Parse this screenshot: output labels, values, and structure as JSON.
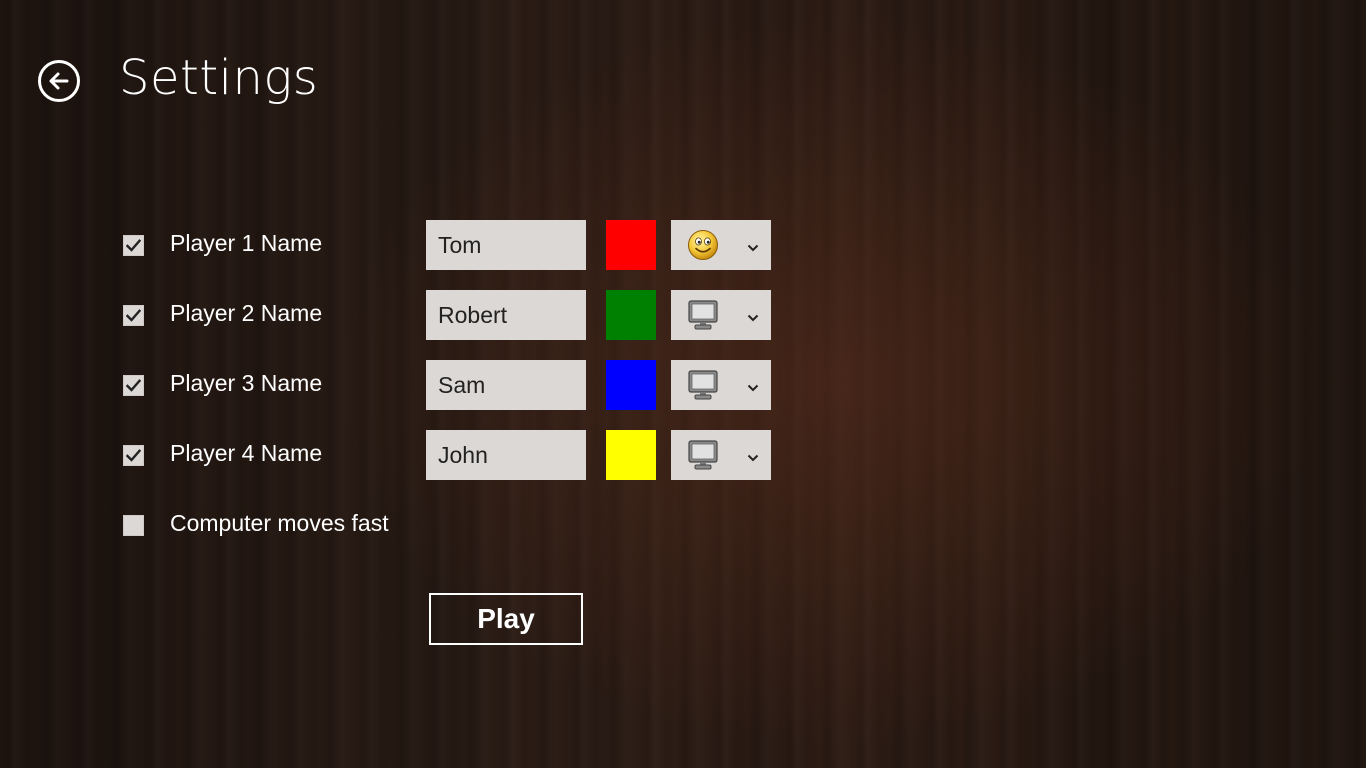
{
  "header": {
    "title": "Settings",
    "back_icon": "back-arrow-icon"
  },
  "players": [
    {
      "checked": true,
      "label": "Player 1 Name",
      "name": "Tom",
      "color": "#ff0000",
      "type_icon": "smiley-face-icon"
    },
    {
      "checked": true,
      "label": "Player 2 Name",
      "name": "Robert",
      "color": "#008000",
      "type_icon": "computer-monitor-icon"
    },
    {
      "checked": true,
      "label": "Player 3 Name",
      "name": "Sam",
      "color": "#0000ff",
      "type_icon": "computer-monitor-icon"
    },
    {
      "checked": true,
      "label": "Player 4 Name",
      "name": "John",
      "color": "#ffff00",
      "type_icon": "computer-monitor-icon"
    }
  ],
  "options": {
    "computer_fast": {
      "checked": false,
      "label": "Computer moves fast"
    }
  },
  "actions": {
    "play_label": "Play"
  }
}
